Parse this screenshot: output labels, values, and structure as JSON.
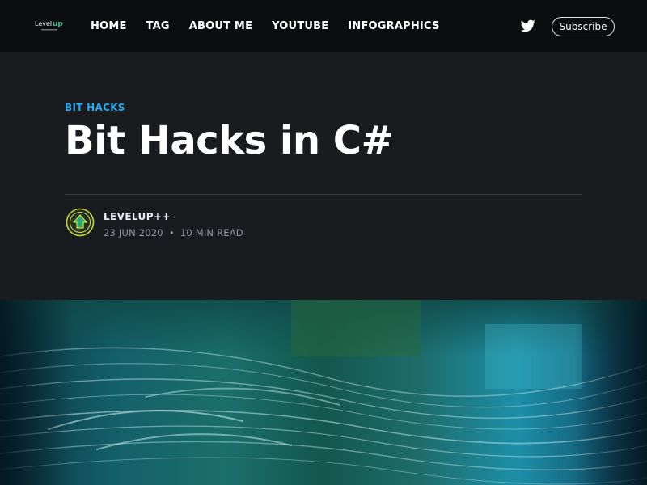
{
  "nav": {
    "logo_icon": "levelup-logo",
    "items": [
      {
        "label": "HOME"
      },
      {
        "label": "TAG"
      },
      {
        "label": "ABOUT ME"
      },
      {
        "label": "YOUTUBE"
      },
      {
        "label": "INFOGRAPHICS"
      }
    ],
    "twitter_icon": "twitter-icon",
    "subscribe_label": "Subscribe"
  },
  "post": {
    "tag": "BIT HACKS",
    "title": "Bit Hacks in C#",
    "author": {
      "avatar_icon": "upload-arrow-avatar",
      "name": "LEVELUP++"
    },
    "date": "23 JUN 2020",
    "separator": "•",
    "read_time": "10 MIN READ"
  },
  "hero": {
    "image_description_icon": "abstract-teal-wave-image"
  },
  "colors": {
    "topbar_bg": "#0b0c0e",
    "page_bg": "#191b1f",
    "accent": "#26a8ed",
    "title": "#ffffff",
    "meta": "#8e9ba5",
    "avatar_ring": "#c9d43a",
    "avatar_arrow": "#2aa56a"
  }
}
